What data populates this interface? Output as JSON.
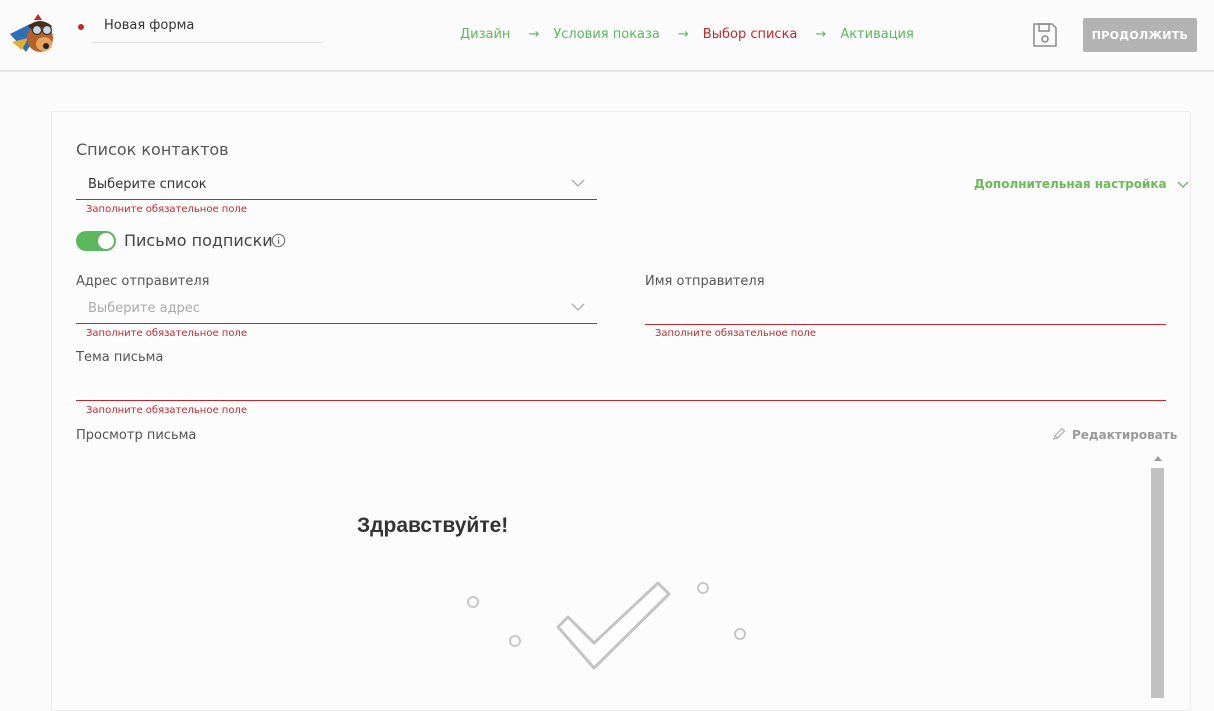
{
  "header": {
    "form_name": "Новая форма",
    "steps": [
      {
        "label": "Дизайн",
        "state": "done"
      },
      {
        "label": "Условия показа",
        "state": "done"
      },
      {
        "label": "Выбор списка",
        "state": "active"
      },
      {
        "label": "Активация",
        "state": "pending"
      }
    ],
    "continue_label": "ПРОДОЛЖИТЬ",
    "save_icon": "floppy-disk-icon",
    "logo_icon": "dog-pilot-logo-icon"
  },
  "contacts": {
    "title": "Список контактов",
    "select_value": "Выберите список",
    "error": "Заполните обязательное поле",
    "extra_settings": "Дополнительная настройка"
  },
  "subscription": {
    "label": "Письмо подписки",
    "enabled": true
  },
  "sender_address": {
    "label": "Адрес отправителя",
    "placeholder": "Выберите адрес",
    "error": "Заполните обязательное поле"
  },
  "sender_name": {
    "label": "Имя отправителя",
    "value": "",
    "error": "Заполните обязательное поле"
  },
  "subject": {
    "label": "Тема письма",
    "value": "",
    "error": "Заполните обязательное поле"
  },
  "preview": {
    "label": "Просмотр письма",
    "edit_label": "Редактировать",
    "greeting": "Здравствуйте!"
  },
  "colors": {
    "accent_green": "#5cb85c",
    "error_red": "#c0282c",
    "button_gray": "#b3b3b3"
  }
}
